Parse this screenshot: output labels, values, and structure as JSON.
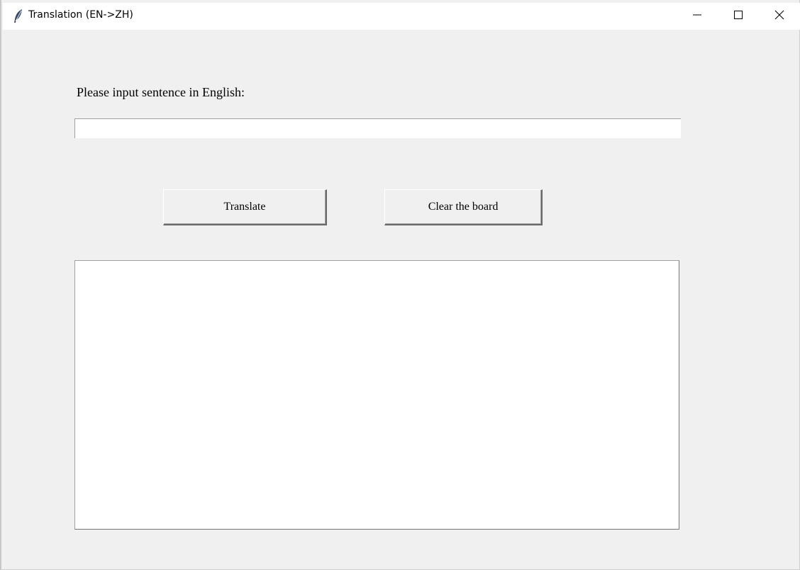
{
  "window": {
    "title": "Translation (EN->ZH)",
    "app_icon": "feather-icon"
  },
  "controls": {
    "minimize_icon": "minimize-icon",
    "maximize_icon": "maximize-icon",
    "close_icon": "close-icon"
  },
  "form": {
    "prompt_label": "Please input sentence in English:",
    "input_value": "",
    "output_value": ""
  },
  "buttons": {
    "translate_label": "Translate",
    "clear_label": "Clear the board"
  },
  "colors": {
    "window_background": "#f0f0f0",
    "titlebar_background": "#ffffff",
    "field_background": "#ffffff"
  }
}
